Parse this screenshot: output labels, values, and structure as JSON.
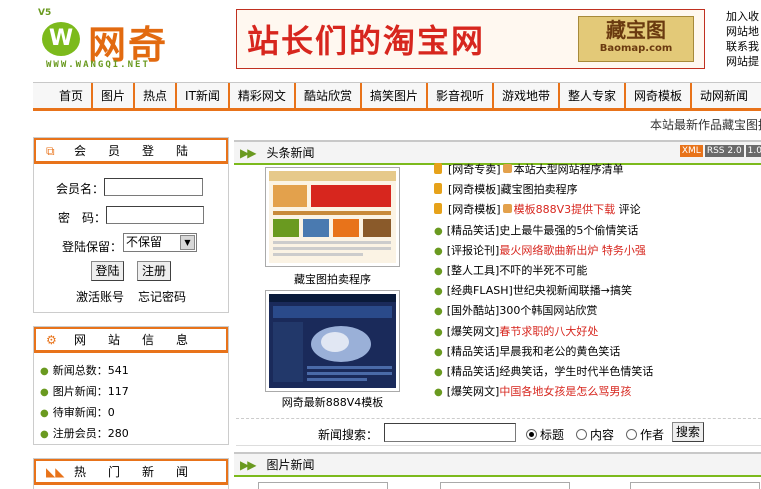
{
  "header": {
    "logo_version": "V5",
    "logo_mark": "W",
    "logo_name": "网奇",
    "logo_url": "WWW.WANGQI.NET",
    "banner_slogan": "站长们的淘宝网",
    "banner_brand": "藏宝图",
    "banner_brand_url": "Baomap.com",
    "top_links": [
      "加入收",
      "网站地",
      "联系我",
      "网站提"
    ]
  },
  "nav": {
    "items": [
      "首页",
      "图片",
      "热点",
      "IT新闻",
      "精彩网文",
      "酷站欣赏",
      "搞笑图片",
      "影音视听",
      "游戏地带",
      "整人专家",
      "网奇模板",
      "动网新闻"
    ]
  },
  "ticker": "本站最新作品藏宝图拍",
  "login": {
    "title": "会员登陆",
    "username_label": "会员名：",
    "password_label": "密　码：",
    "keep_label": "登陆保留：",
    "keep_value": "不保留",
    "login_button": "登陆",
    "register_button": "注册",
    "activate_link": "激活账号",
    "forgot_link": "忘记密码"
  },
  "site_info": {
    "title": "网站信息",
    "stats": [
      {
        "label": "新闻总数：",
        "value": "541"
      },
      {
        "label": "图片新闻：",
        "value": "117"
      },
      {
        "label": "待审新闻：",
        "value": "0"
      },
      {
        "label": "注册会员：",
        "value": "280"
      }
    ]
  },
  "hot_news": {
    "title": "热门新闻"
  },
  "headline": {
    "title": "头条新闻",
    "badges": [
      "XML",
      "RSS 2.0",
      "1.0"
    ],
    "thumbs": [
      {
        "caption": "藏宝图拍卖程序"
      },
      {
        "caption": "网奇最新888V4模板"
      }
    ],
    "news": [
      {
        "category": "[网奇专卖]",
        "title": "本站大型网站程序清单",
        "extra": "",
        "pin": true,
        "lock": true,
        "red": false
      },
      {
        "category": "[网奇模板]",
        "title": "藏宝图拍卖程序",
        "extra": "",
        "pin": true,
        "lock": false,
        "red": false
      },
      {
        "category": "[网奇模板]",
        "title": "模板888V3提供下载",
        "extra": "评论",
        "pin": true,
        "lock": true,
        "red": true
      },
      {
        "category": "[精品笑话]",
        "title": "史上最牛最强的5个偷情笑话",
        "extra": "",
        "pin": false,
        "lock": false,
        "red": false
      },
      {
        "category": "[评报论刊]",
        "title": "最火网络歌曲新出炉 特务小强",
        "extra": "",
        "pin": false,
        "lock": false,
        "red": true
      },
      {
        "category": "[整人工具]",
        "title": "不吓的半死不可能",
        "extra": "",
        "pin": false,
        "lock": false,
        "red": false
      },
      {
        "category": "[经典FLASH]",
        "title": "世纪央视新闻联播→搞笑",
        "extra": "",
        "pin": false,
        "lock": false,
        "red": false
      },
      {
        "category": "[国外酷站]",
        "title": "300个韩国网站欣赏",
        "extra": "",
        "pin": false,
        "lock": false,
        "red": false
      },
      {
        "category": "[爆笑网文]",
        "title": "春节求职的八大好处",
        "extra": "",
        "pin": false,
        "lock": false,
        "red": true
      },
      {
        "category": "[精品笑话]",
        "title": "早晨我和老公的黄色笑话",
        "extra": "",
        "pin": false,
        "lock": false,
        "red": false
      },
      {
        "category": "[精品笑话]",
        "title": "经典笑话，学生时代半色情笑话",
        "extra": "",
        "pin": false,
        "lock": false,
        "red": false
      },
      {
        "category": "[爆笑网文]",
        "title": "中国各地女孩是怎么骂男孩",
        "extra": "",
        "pin": false,
        "lock": false,
        "red": true
      }
    ]
  },
  "search": {
    "label": "新闻搜索：",
    "options": [
      "标题",
      "内容",
      "作者"
    ],
    "selected": "标题",
    "button": "搜索"
  },
  "pic_news": {
    "title": "图片新闻"
  },
  "colors": {
    "accent_orange": "#e8731a",
    "accent_green": "#7cba1c",
    "link_red": "#d7261e"
  }
}
